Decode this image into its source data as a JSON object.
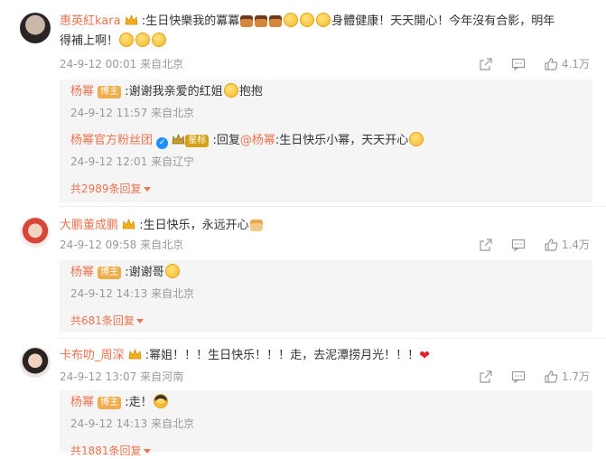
{
  "comments": [
    {
      "name": "惠英紅kara",
      "text": ":生日快樂我的冪冪",
      "text2": "身體健康！天天開心！今年沒有合影，明年",
      "text3": "得補上啊！",
      "date": "24-9-12 00:01",
      "location": "来自北京",
      "likes": "4.1万",
      "replies": [
        {
          "name": "杨幂",
          "badge": "博主",
          "text": ":谢谢我亲爱的红姐",
          "text_after": "抱抱",
          "date": "24-9-12 11:57",
          "location": "来自北京"
        },
        {
          "name": "杨幂官方粉丝团",
          "badge": "星标",
          "text": ":回复",
          "mention": "@杨幂",
          "text_after": ":生日快乐小幂，天天开心",
          "date": "24-9-12 12:01",
          "location": "来自辽宁"
        }
      ],
      "more": "共2989条回复"
    },
    {
      "name": "大鹏董成鹏",
      "text": ":生日快乐，永远开心",
      "date": "24-9-12 09:58",
      "location": "来自北京",
      "likes": "1.4万",
      "replies": [
        {
          "name": "杨幂",
          "badge": "博主",
          "text": ":谢谢哥",
          "date": "24-9-12 14:13",
          "location": "来自北京"
        }
      ],
      "more": "共681条回复"
    },
    {
      "name": "卡布叻_周深",
      "text": ":幂姐！！！生日快乐！！！走，去泥潭捞月光！！！",
      "date": "24-9-12 13:07",
      "location": "来自河南",
      "likes": "1.7万",
      "replies": [
        {
          "name": "杨幂",
          "badge": "博主",
          "text": ":走！",
          "date": "24-9-12 14:13",
          "location": "来自北京"
        }
      ],
      "more": "共1881条回复"
    }
  ],
  "colors": {
    "name": "#eb7350",
    "meta": "#999999",
    "badge_blogger": "#f0ad4e",
    "badge_star": "#d4a017"
  }
}
